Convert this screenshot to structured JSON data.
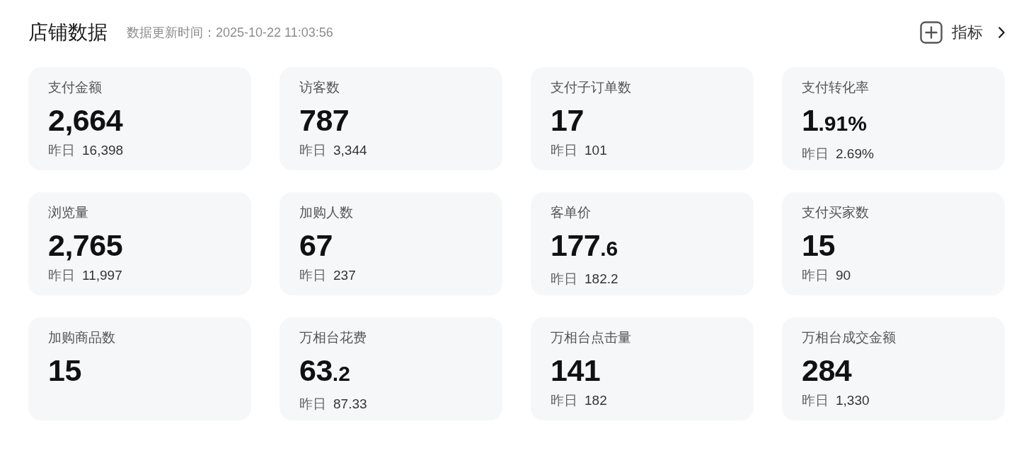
{
  "header": {
    "title": "店铺数据",
    "updated": "数据更新时间：2025-10-22 11:03:56",
    "metrics_button": "指标"
  },
  "metrics": [
    {
      "label": "支付金额",
      "value": "2,664",
      "previous_label": "昨日",
      "previous": "16,398"
    },
    {
      "label": "访客数",
      "value": "787",
      "previous_label": "昨日",
      "previous": "3,344"
    },
    {
      "label": "支付子订单数",
      "value": "17",
      "previous_label": "昨日",
      "previous": "101"
    },
    {
      "label": "支付转化率",
      "value": "1.91%",
      "previous_label": "昨日",
      "previous": "2.69%"
    },
    {
      "label": "浏览量",
      "value": "2,765",
      "previous_label": "昨日",
      "previous": "11,997"
    },
    {
      "label": "加购人数",
      "value": "67",
      "previous_label": "昨日",
      "previous": "237"
    },
    {
      "label": "客单价",
      "value": "177.6",
      "previous_label": "昨日",
      "previous": "182.2"
    },
    {
      "label": "支付买家数",
      "value": "15",
      "previous_label": "昨日",
      "previous": "90"
    },
    {
      "label": "加购商品数",
      "value": "15"
    },
    {
      "label": "万相台花费",
      "value": "63.2",
      "previous_label": "昨日",
      "previous": "87.33"
    },
    {
      "label": "万相台点击量",
      "value": "141",
      "previous_label": "昨日",
      "previous": "182"
    },
    {
      "label": "万相台成交金额",
      "value": "284",
      "previous_label": "昨日",
      "previous": "1,330"
    }
  ]
}
